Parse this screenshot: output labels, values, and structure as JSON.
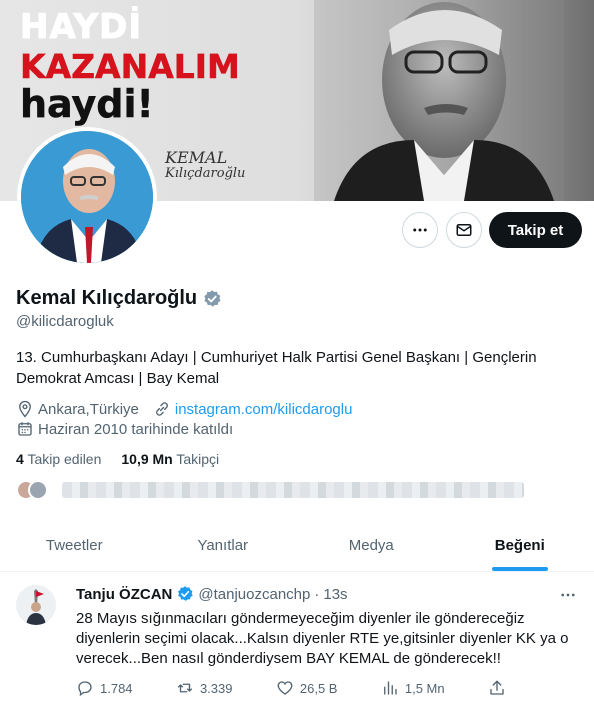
{
  "banner": {
    "line1": "HAYDİ",
    "line2": "KAZANALIM",
    "line3": "haydi!",
    "signature_line1": "KEMAL",
    "signature_line2": "Kılıçdaroğlu"
  },
  "actions": {
    "more_icon": "more-horizontal-icon",
    "message_icon": "envelope-icon",
    "follow_label": "Takip et"
  },
  "profile": {
    "name": "Kemal Kılıçdaroğlu",
    "verified_icon": "verified-badge-icon",
    "handle": "@kilicdarogluk",
    "bio": "13. Cumhurbaşkanı Adayı | Cumhuriyet Halk Partisi Genel Başkanı | Gençlerin Demokrat Amcası | Bay Kemal",
    "location": "Ankara,Türkiye",
    "website": "instagram.com/kilicdaroglu",
    "joined": "Haziran 2010 tarihinde katıldı",
    "following_count": "4",
    "following_label": "Takip edilen",
    "followers_count": "10,9 Mn",
    "followers_label": "Takipçi"
  },
  "tabs": [
    {
      "label": "Tweetler"
    },
    {
      "label": "Yanıtlar"
    },
    {
      "label": "Medya"
    },
    {
      "label": "Beğeni"
    }
  ],
  "active_tab": "Beğeni",
  "tweet": {
    "author_name": "Tanju ÖZCAN",
    "author_handle": "@tanjuozcanchp",
    "separator": "·",
    "time": "13s",
    "text": "28 Mayıs sığınmacıları göndermeyeceğim diyenler ile göndereceğiz diyenlerin seçimi olacak...Kalsın diyenler RTE ye,gitsinler diyenler KK ya o verecek...Ben nasıl gönderdiysem BAY KEMAL de gönderecek!!",
    "replies": "1.784",
    "retweets": "3.339",
    "likes": "26,5 B",
    "views": "1,5 Mn"
  },
  "colors": {
    "accent": "#1d9bf0",
    "text_primary": "#0f1419",
    "text_secondary": "#536471",
    "brand_red": "#d6121d"
  }
}
